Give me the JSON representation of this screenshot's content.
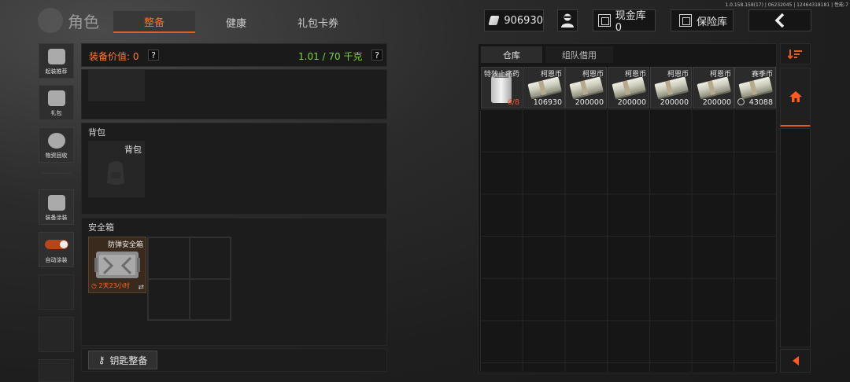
{
  "version": "1.0.158.158(17) | 06232045 | 12464318181 | 性能-7",
  "header": {
    "title": "角色",
    "tabs": [
      {
        "label": "整备",
        "active": true
      },
      {
        "label": "健康",
        "active": false
      },
      {
        "label": "礼包卡券",
        "active": false
      }
    ],
    "currency_amount": "906930",
    "cash_vault_label": "现金库 0",
    "insurance_label": "保险库"
  },
  "sidebar": {
    "items": [
      {
        "label": "起装推荐",
        "icon": "helmet-icon"
      },
      {
        "label": "礼包",
        "icon": "gift-icon"
      },
      {
        "label": "物资回收",
        "icon": "recycle-icon"
      },
      {
        "label": "装备涂装",
        "icon": "paint-icon"
      },
      {
        "label": "自动涂装",
        "icon": "toggle-icon"
      }
    ]
  },
  "loadout": {
    "value_label": "装备价值: 0",
    "weight": "1.01 / 70 千克",
    "help": "?",
    "backpack_section": "背包",
    "backpack_slot": "背包",
    "safebox_section": "安全箱",
    "safebox_name": "防弹安全箱",
    "safebox_timer": "2天23小时",
    "key_button": "钥匙整备"
  },
  "stash": {
    "tabs": [
      {
        "label": "仓库",
        "active": true
      },
      {
        "label": "组队借用",
        "active": false
      }
    ],
    "items": [
      {
        "name": "特效止痛药",
        "count": "6/8",
        "kind": "bottle"
      },
      {
        "name": "柯恩币",
        "count": "106930",
        "kind": "money"
      },
      {
        "name": "柯恩币",
        "count": "200000",
        "kind": "money"
      },
      {
        "name": "柯恩币",
        "count": "200000",
        "kind": "money"
      },
      {
        "name": "柯恩币",
        "count": "200000",
        "kind": "money"
      },
      {
        "name": "柯恩币",
        "count": "200000",
        "kind": "money"
      },
      {
        "name": "赛季币",
        "count": "43088",
        "kind": "money"
      }
    ]
  },
  "colors": {
    "accent": "#e05d1f",
    "weight_green": "#7bd63a",
    "value_orange": "#ff7a33",
    "warning_red": "#ff4d2e"
  }
}
